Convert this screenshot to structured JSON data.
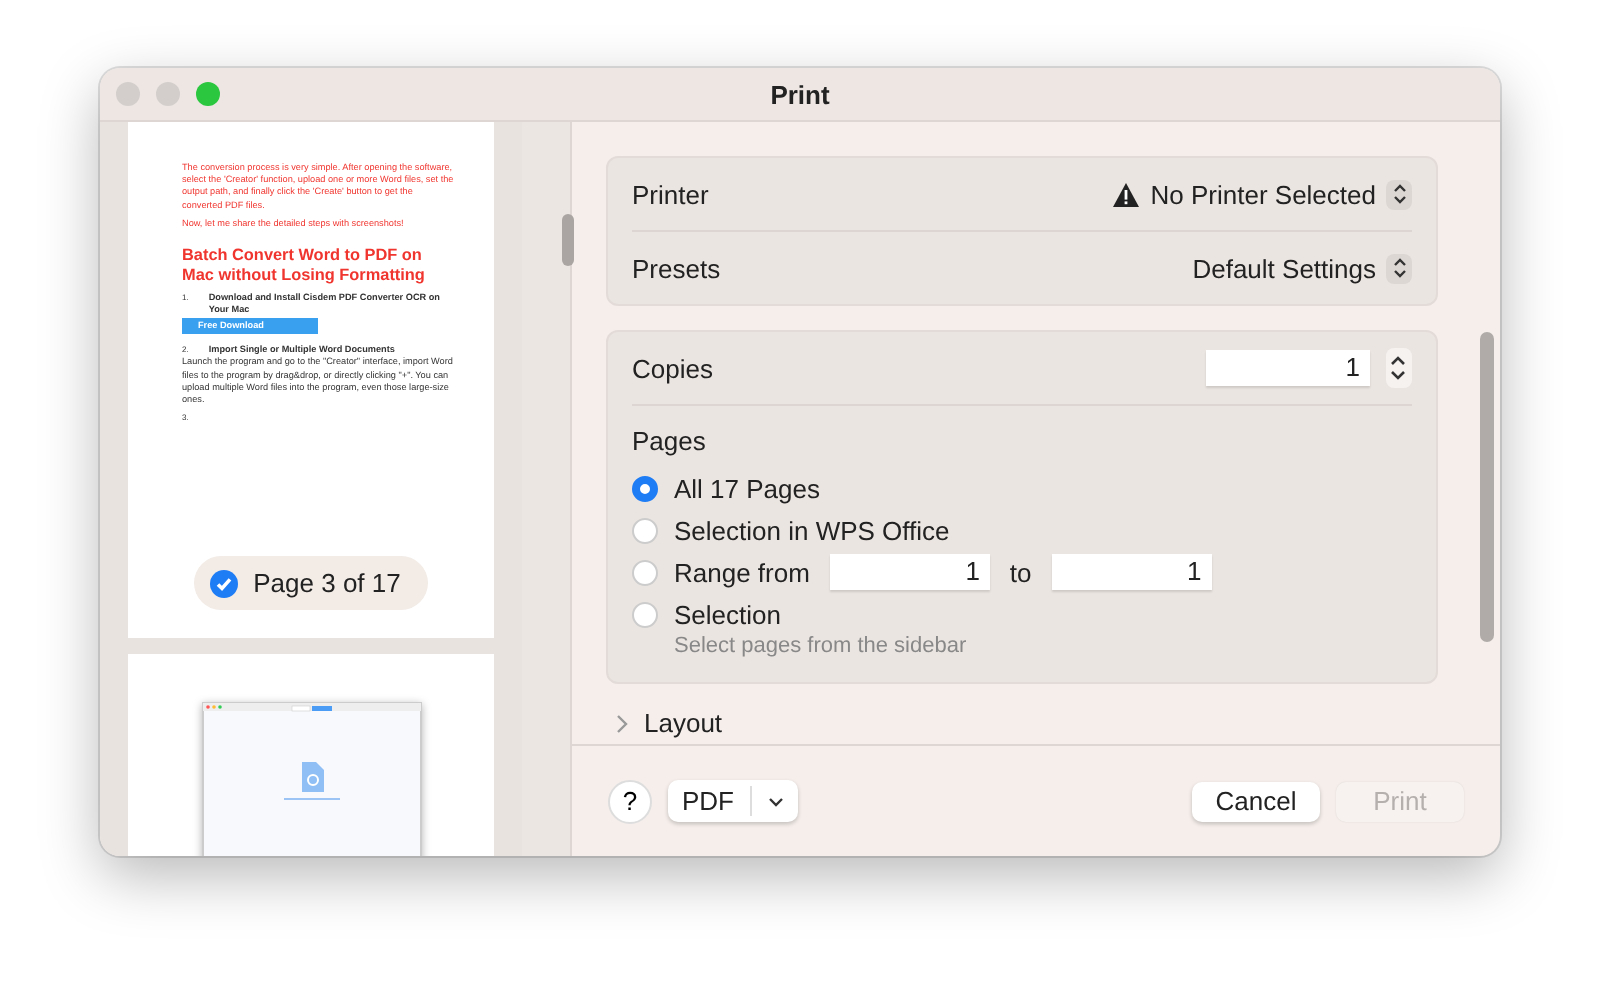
{
  "window": {
    "title": "Print"
  },
  "preview": {
    "intro": [
      "The conversion process is very simple. After opening the software, select the 'Creator' function, upload one or more Word files, set the output path, and finally click the 'Create' button to get the converted PDF files.",
      "Now, let me share the detailed steps with screenshots!"
    ],
    "heading": "Batch Convert Word to PDF on Mac without Losing Formatting",
    "steps": [
      {
        "number": "1.",
        "title": "Download and Install Cisdem PDF Converter OCR on Your Mac",
        "button": "Free Download"
      },
      {
        "number": "2.",
        "title": "Import Single or Multiple Word Documents",
        "body": "Launch the program and go to the \"Creator\" interface, import Word files to the program by drag&drop, or directly clicking \"+\". You can upload multiple Word files into the program, even those large-size ones."
      },
      {
        "number": "3."
      }
    ],
    "page_badge": {
      "label": "Page 3 of 17",
      "selected": true
    }
  },
  "settings": [
    {
      "label": "Printer",
      "value": "No Printer Selected",
      "warning": true
    },
    {
      "label": "Presets",
      "value": "Default Settings",
      "warning": false
    }
  ],
  "copies": {
    "label": "Copies",
    "value": "1"
  },
  "pages": {
    "label": "Pages",
    "options": [
      {
        "kind": "plain",
        "label": "All 17 Pages",
        "selected": true
      },
      {
        "kind": "plain",
        "label": "Selection in WPS Office",
        "selected": false
      },
      {
        "kind": "range",
        "label": "Range from",
        "from": "1",
        "to_label": "to",
        "to": "1",
        "selected": false
      },
      {
        "kind": "hint",
        "label": "Selection",
        "hint": "Select pages from the sidebar",
        "selected": false
      }
    ]
  },
  "layout": {
    "label": "Layout",
    "expanded": false
  },
  "buttons": {
    "help": "?",
    "pdf": "PDF",
    "cancel": "Cancel",
    "print": {
      "label": "Print",
      "disabled": true
    }
  }
}
